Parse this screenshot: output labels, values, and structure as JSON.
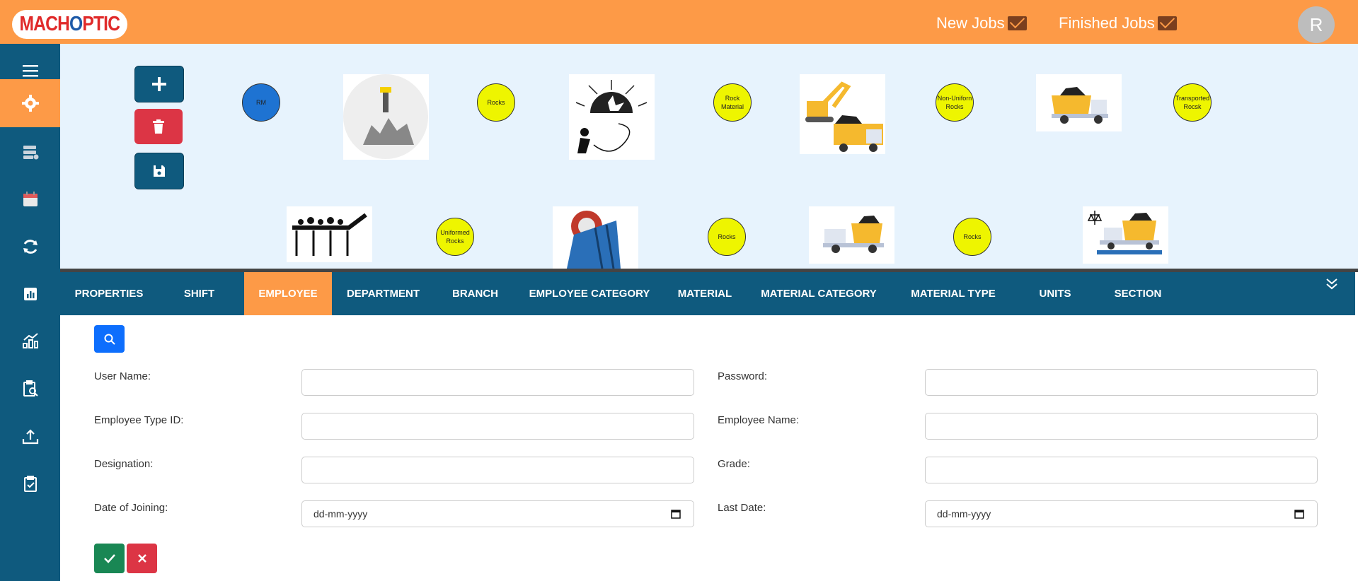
{
  "header": {
    "logo_text_pre": "MACH",
    "logo_text_post": "PTIC",
    "new_jobs_label": "New Jobs",
    "finished_jobs_label": "Finished Jobs",
    "avatar_initial": "R"
  },
  "sidebar": {
    "items": [
      "menu",
      "settings",
      "database",
      "calendar",
      "refresh",
      "report",
      "analytics",
      "inspection",
      "upload",
      "checklist"
    ]
  },
  "flow": {
    "row1": [
      "RM",
      "drilling",
      "Rocks",
      "blasting",
      "Rock Material",
      "excavator-loading",
      "Non-Uniforn Rocks",
      "truck",
      "Transported Rocsk"
    ],
    "row2": [
      "conveyor",
      "Uniformed Rocks",
      "crusher",
      "Rocks",
      "truck",
      "Rocks",
      "weighbridge-truck"
    ]
  },
  "tabs": [
    "PROPERTIES",
    "SHIFT",
    "EMPLOYEE",
    "DEPARTMENT",
    "BRANCH",
    "EMPLOYEE CATEGORY",
    "MATERIAL",
    "MATERIAL CATEGORY",
    "MATERIAL TYPE",
    "UNITS",
    "SECTION"
  ],
  "active_tab": "EMPLOYEE",
  "form": {
    "user_name_label": "User Name:",
    "password_label": "Password:",
    "employee_type_id_label": "Employee Type ID:",
    "employee_name_label": "Employee Name:",
    "designation_label": "Designation:",
    "grade_label": "Grade:",
    "date_of_joining_label": "Date of Joining:",
    "last_date_label": "Last Date:",
    "date_placeholder": "dd-mm-yyyy"
  },
  "colors": {
    "header": "#fd9a47",
    "sidebar": "#0f5a7e",
    "canvas": "#e7f3fd",
    "node_yellow": "#eef500",
    "node_blue": "#1e73d2",
    "primary": "#0d6efd",
    "danger": "#dc3545",
    "success": "#198754"
  }
}
